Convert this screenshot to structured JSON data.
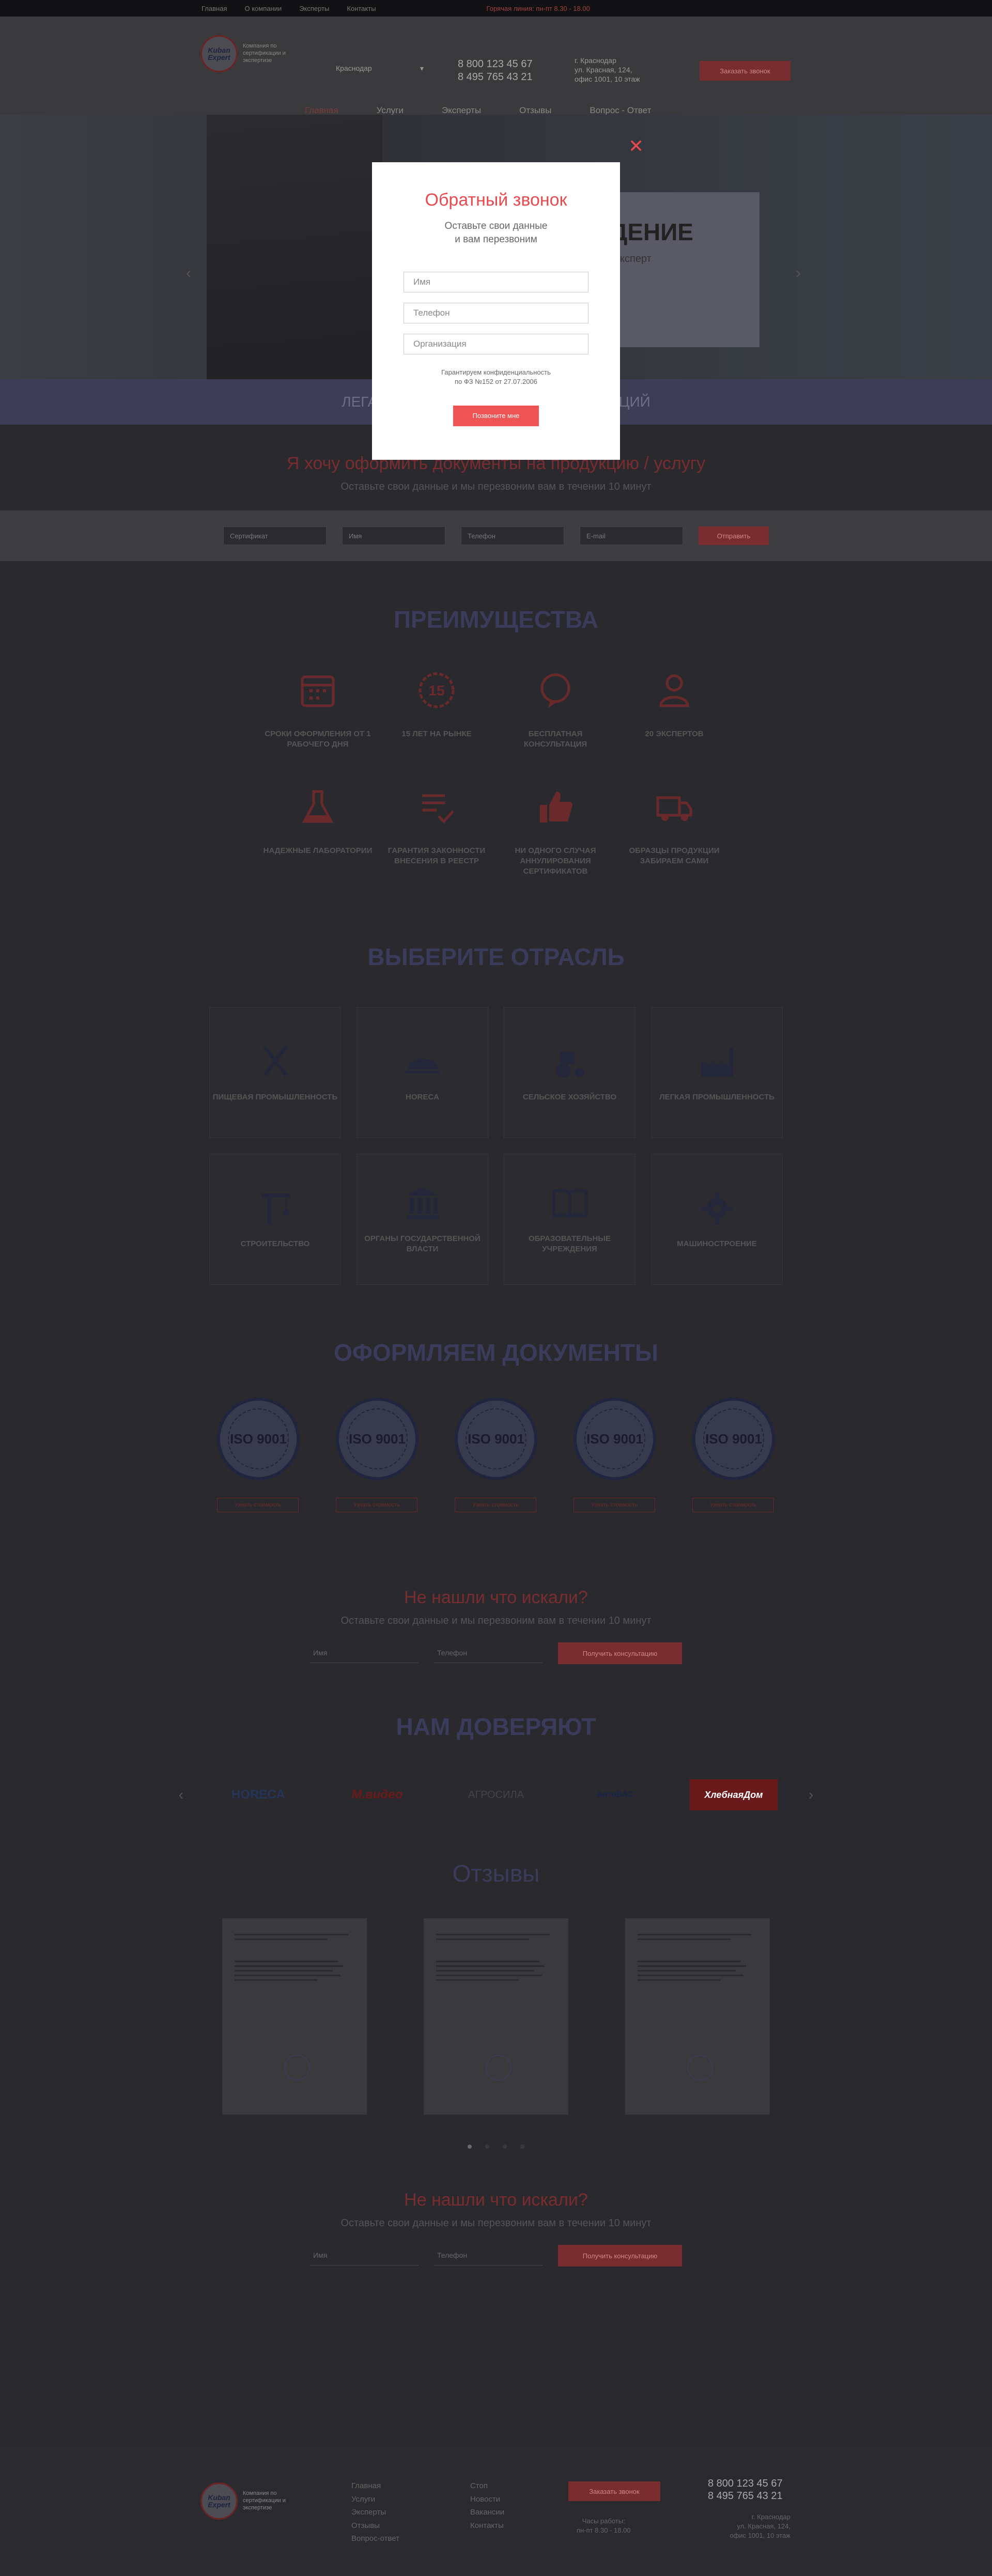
{
  "topbar": {
    "links": [
      "Главная",
      "О компании",
      "Эксперты",
      "Контакты"
    ],
    "hotline": "Горячая линия: пн-пт 8.30 - 18.00"
  },
  "header": {
    "logo_text": "Kuban Expert",
    "logo_caption": "Компания по сертификации и экспертизе",
    "city": "Краснодар",
    "phones": [
      "8 800 123 45 67",
      "8 495 765 43 21"
    ],
    "address": [
      "г. Краснодар",
      "ул. Красная, 124,",
      "офис 1001, 10 этаж"
    ],
    "cta": "Заказать звонок"
  },
  "nav": {
    "items": [
      "Главная",
      "Услуги",
      "Эксперты",
      "Отзывы",
      "Вопрос - Ответ"
    ]
  },
  "hero": {
    "title": "ЖДЕНИЕ",
    "subtitle": "ож эксперт",
    "strip": "ЛЕГАЛЬНО ОФОРМЛЯЕМ ... И ДЕКЛАРАЦИЙ"
  },
  "order": {
    "title": "Я хочу оформить документы на продукцию / услугу",
    "subtitle": "Оставьте свои данные и мы перезвоним вам в течении 10 минут",
    "fields": [
      "Сертификат",
      "Имя",
      "Телефон",
      "E-mail"
    ],
    "button": "Отправить"
  },
  "advantages": {
    "title": "ПРЕИМУЩЕСТВА",
    "items": [
      {
        "icon": "calendar-icon",
        "label": "СРОКИ ОФОРМЛЕНИЯ ОТ 1 РАБОЧЕГО ДНЯ"
      },
      {
        "icon": "badge-15-icon",
        "label": "15 ЛЕТ НА РЫНКЕ"
      },
      {
        "icon": "consultation-icon",
        "label": "БЕСПЛАТНАЯ КОНСУЛЬТАЦИЯ"
      },
      {
        "icon": "person-icon",
        "label": "20 ЭКСПЕРТОВ"
      },
      {
        "icon": "flask-icon",
        "label": "НАДЕЖНЫЕ ЛАБОРАТОРИИ"
      },
      {
        "icon": "checklist-icon",
        "label": "ГАРАНТИЯ ЗАКОННОСТИ ВНЕСЕНИЯ В РЕЕСТР"
      },
      {
        "icon": "thumbs-up-icon",
        "label": "НИ ОДНОГО СЛУЧАЯ АННУЛИРОВАНИЯ СЕРТИФИКАТОВ"
      },
      {
        "icon": "truck-icon",
        "label": "ОБРАЗЦЫ ПРОДУКЦИИ ЗАБИРАЕМ САМИ"
      }
    ]
  },
  "industries": {
    "title": "ВЫБЕРИТЕ ОТРАСЛЬ",
    "items": [
      {
        "icon": "cutlery-icon",
        "label": "ПИЩЕВАЯ ПРОМЫШЛЕННОСТЬ"
      },
      {
        "icon": "cloche-icon",
        "label": "HOREСA"
      },
      {
        "icon": "tractor-icon",
        "label": "СЕЛЬСКОЕ ХОЗЯЙСТВО"
      },
      {
        "icon": "factory-icon",
        "label": "ЛЕГКАЯ ПРОМЫШЛЕННОСТЬ"
      },
      {
        "icon": "crane-icon",
        "label": "СТРОИТЕЛЬСТВО"
      },
      {
        "icon": "government-icon",
        "label": "ОРГАНЫ ГОСУДАРСТВЕННОЙ ВЛАСТИ"
      },
      {
        "icon": "book-icon",
        "label": "ОБРАЗОВАТЕЛЬНЫЕ УЧРЕЖДЕНИЯ"
      },
      {
        "icon": "gear-icon",
        "label": "МАШИНОСТРОЕНИЕ"
      }
    ]
  },
  "documents": {
    "title": "ОФОРМЛЯЕМ ДОКУМЕНТЫ",
    "seal_text": "ISO 9001",
    "button": "Узнать стоимость",
    "count": 5
  },
  "not_found_1": {
    "title": "Не нашли что искали?",
    "subtitle": "Оставьте свои данные и мы перезвоним вам в течении 10 минут",
    "fields": [
      "Имя",
      "Телефон"
    ],
    "button": "Получить консультацию"
  },
  "trust": {
    "title": "НАМ ДОВЕРЯЮТ",
    "logos": [
      "HORECA",
      "М.видео",
      "АГРОСИЛА",
      "АвтоВАЗ",
      "ХлебнаяДом"
    ]
  },
  "reviews": {
    "title": "Отзывы",
    "count": 3
  },
  "not_found_2": {
    "title": "Не нашли что искали?",
    "subtitle": "Оставьте свои данные и мы перезвоним вам в течении 10 минут",
    "fields": [
      "Имя",
      "Телефон"
    ],
    "button": "Получить консультацию"
  },
  "footer": {
    "col1": [
      "Главная",
      "Услуги",
      "Эксперты",
      "Отзывы",
      "Вопрос-ответ"
    ],
    "col2": [
      "Стоп",
      "Новости",
      "Вакансии",
      "Контакты"
    ],
    "cta": "Заказать звонок",
    "hours": [
      "Часы работы:",
      "пн-пт 8.30 - 18.00"
    ],
    "phones": [
      "8 800 123 45 67",
      "8 495 765 43 21"
    ],
    "address": [
      "г. Краснодар",
      "ул. Красная, 124,",
      "офис 1001, 10 этаж"
    ]
  },
  "modal": {
    "title": "Обратный звонок",
    "subtitle_1": "Оставьте свои данные",
    "subtitle_2": "и вам перезвоним",
    "name_placeholder": "Имя",
    "phone_placeholder": "Телефон",
    "org_placeholder": "Организация",
    "note_1": "Гарантируем конфиденциальность",
    "note_2": "по ФЗ №152 от 27.07.2006",
    "button": "Позвоните мне",
    "close": "✕"
  },
  "colors": {
    "accent": "#e84a4f",
    "button": "#ef5454",
    "navy": "#22253e"
  }
}
